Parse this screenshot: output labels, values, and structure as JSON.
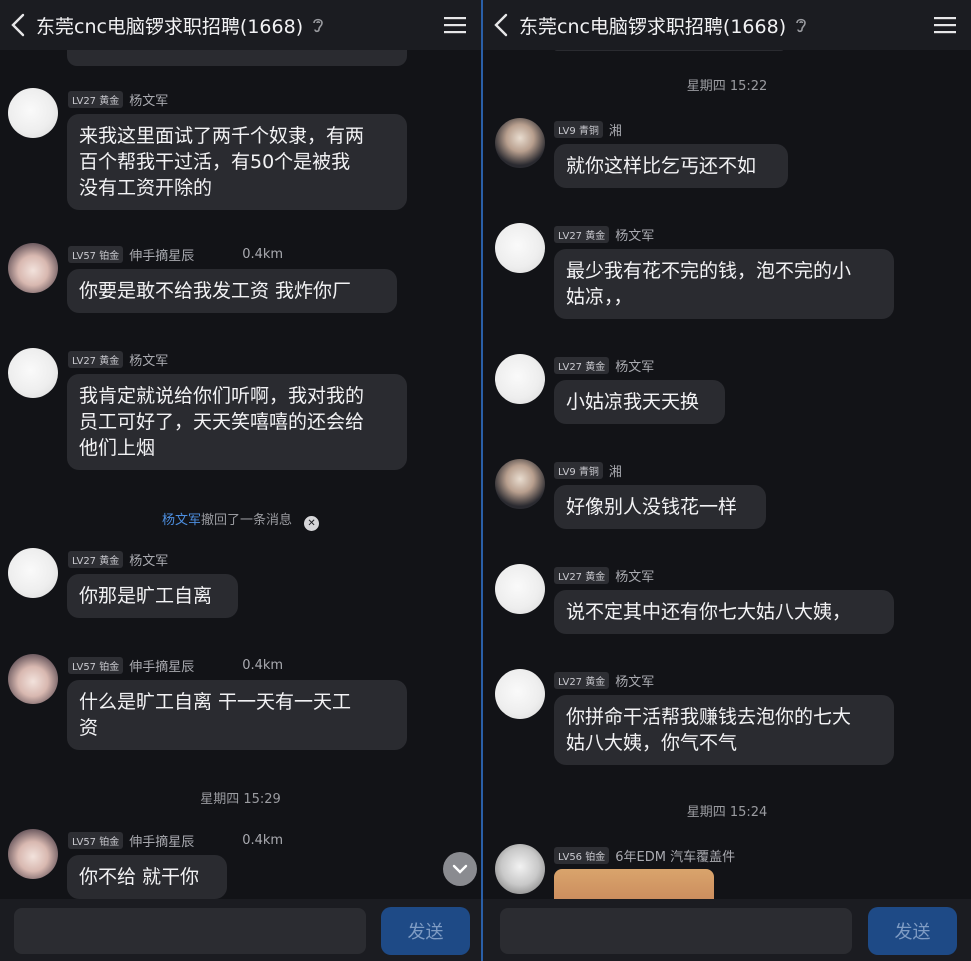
{
  "title": "东莞cnc电脑锣求职招聘(1668)",
  "send_label": "发送",
  "left": {
    "messages": [
      {
        "badge": "LV27 黄金",
        "name": "杨文军",
        "dist": "",
        "text1": "来我这里面试了两千个奴隶，有两",
        "text2": "百个帮我干过活，有50个是被我",
        "text3": "没有工资开除的"
      },
      {
        "badge": "LV57 铂金",
        "name": "伸手摘星辰",
        "dist": "0.4km",
        "text1": "你要是敢不给我发工资  我炸你厂"
      },
      {
        "badge": "LV27 黄金",
        "name": "杨文军",
        "dist": "",
        "text1": "我肯定就说给你们听啊，我对我的",
        "text2": "员工可好了，天天笑嘻嘻的还会给",
        "text3": "他们上烟"
      },
      {
        "badge": "LV27 黄金",
        "name": "杨文军",
        "dist": "",
        "text1": "你那是旷工自离"
      },
      {
        "badge": "LV57 铂金",
        "name": "伸手摘星辰",
        "dist": "0.4km",
        "text1": "什么是旷工自离  干一天有一天工",
        "text2": "资"
      },
      {
        "badge": "LV57 铂金",
        "name": "伸手摘星辰",
        "dist": "0.4km",
        "text1": "你不给  就干你"
      }
    ],
    "recall_who": "杨文军",
    "recall_text": "撤回了一条消息",
    "time": "星期四 15:29"
  },
  "right": {
    "time1": "星期四 15:22",
    "time2": "星期四 15:24",
    "messages": [
      {
        "badge": "LV9 青铜",
        "name": "湘",
        "text1": "就你这样比乞丐还不如"
      },
      {
        "badge": "LV27 黄金",
        "name": "杨文军",
        "text1": "最少我有花不完的钱，泡不完的小",
        "text2": "姑凉，，"
      },
      {
        "badge": "LV27 黄金",
        "name": "杨文军",
        "text1": "小姑凉我天天换"
      },
      {
        "badge": "LV9 青铜",
        "name": "湘",
        "text1": "好像别人没钱花一样"
      },
      {
        "badge": "LV27 黄金",
        "name": "杨文军",
        "text1": "说不定其中还有你七大姑八大姨，"
      },
      {
        "badge": "LV27 黄金",
        "name": "杨文军",
        "text1": "你拼命干活帮我赚钱去泡你的七大",
        "text2": "姑八大姨，你气不气"
      },
      {
        "badge": "LV56 铂金",
        "name": "6年EDM 汽车覆盖件"
      }
    ]
  }
}
